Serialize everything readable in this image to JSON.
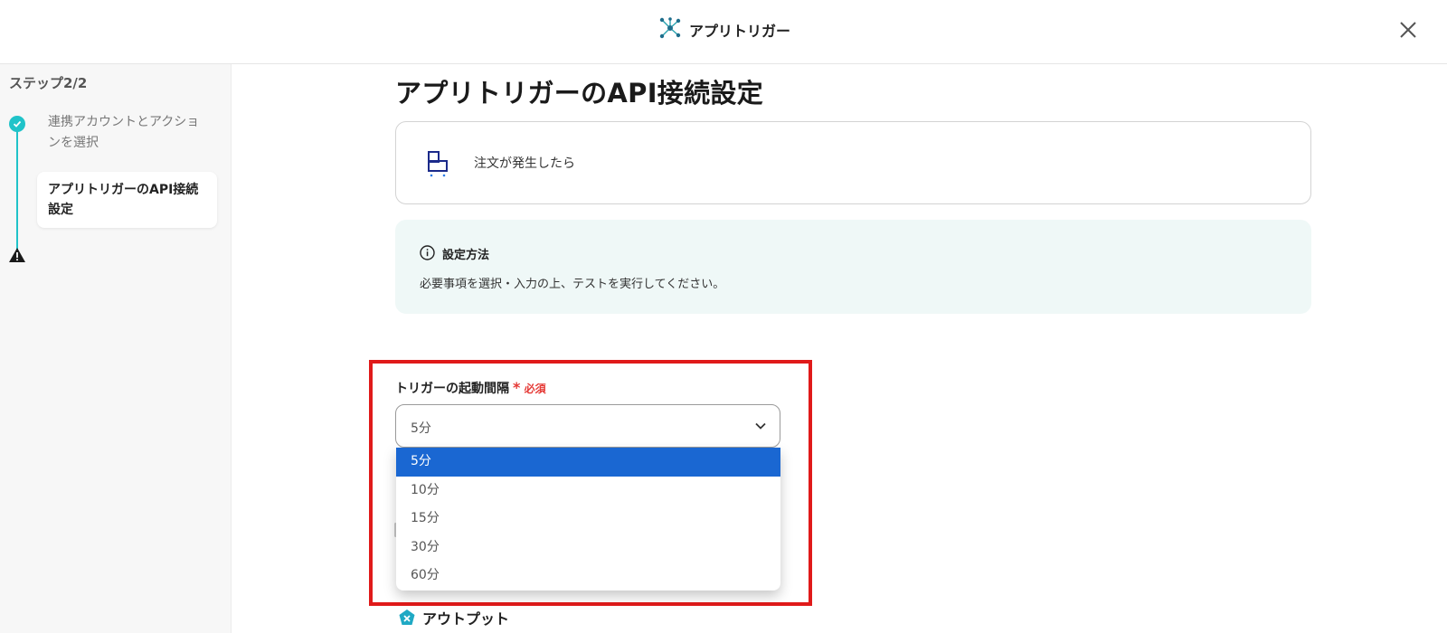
{
  "header": {
    "app_title": "アプリトリガー",
    "logo_icon": "network-nodes-icon",
    "close_icon": "close-icon"
  },
  "sidebar": {
    "step_count": "ステップ2/2",
    "steps": [
      {
        "label": "連携アカウントとアクションを選択",
        "status": "completed",
        "icon": "check-circle-icon"
      },
      {
        "label": "アプリトリガーのAPI接続設定",
        "status": "warning",
        "icon": "warning-triangle-icon"
      }
    ]
  },
  "main": {
    "page_title": "アプリトリガーのAPI接続設定",
    "trigger_card": {
      "icon": "shopping-cart-icon",
      "label": "注文が発生したら"
    },
    "info_box": {
      "icon": "info-circle-icon",
      "title": "設定方法",
      "text": "必要事項を選択・入力の上、テストを実行してください。"
    },
    "interval_field": {
      "label": "トリガーの起動間隔",
      "required_star": "*",
      "required_text": "必須",
      "selected_value": "5分",
      "options": [
        "5分",
        "10分",
        "15分",
        "30分",
        "60分"
      ],
      "selected_index": 0
    },
    "output": {
      "icon": "output-x-icon",
      "label": "アウトプット"
    }
  },
  "colors": {
    "accent_teal": "#20c3c9",
    "highlight_red": "#e01a1a",
    "selected_blue": "#1a67d2",
    "required_red": "#e53935",
    "info_bg": "#eff8f7"
  }
}
